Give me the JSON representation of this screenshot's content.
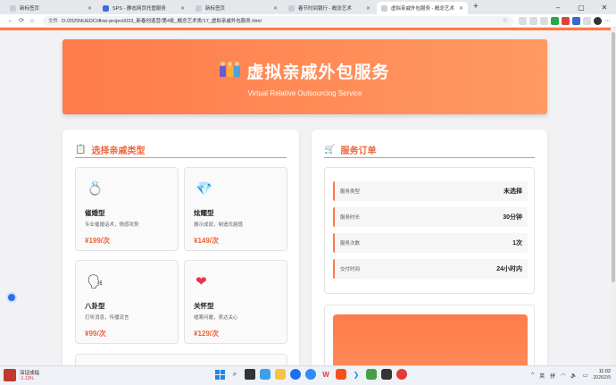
{
  "tabs": [
    {
      "label": "新标签页",
      "active": false
    },
    {
      "label": "SPS - 静态网页托管服务",
      "active": false
    },
    {
      "label": "新标签页",
      "active": false
    },
    {
      "label": "春节时间银行 - 概念艺术",
      "active": false
    },
    {
      "label": "虚拟亲戚外包服务 - 概念艺术",
      "active": true
    }
  ],
  "address": {
    "scheme_label": "文件",
    "url": "D:/2025NUEDC/iflow-project/033_新春创造营/第4批_概念艺术类/17_虚拟亲戚外包服务.html"
  },
  "hero": {
    "title": "虚拟亲戚外包服务",
    "subtitle": "Virtual Relative Outsourcing Service"
  },
  "left_card": {
    "title": "选择亲戚类型",
    "icon": "clipboard-icon",
    "options": [
      {
        "icon": "ring-icon",
        "glyph": "💍",
        "name": "催婚型",
        "desc": "专业催婚话术，情感攻势",
        "price": "¥199/次"
      },
      {
        "icon": "gem-icon",
        "glyph": "💎",
        "name": "炫耀型",
        "desc": "展示成就，制造优越感",
        "price": "¥149/次"
      },
      {
        "icon": "gossip-icon",
        "glyph": "🗣",
        "name": "八卦型",
        "desc": "打听消息，传播流言",
        "price": "¥99/次"
      },
      {
        "icon": "heart-icon",
        "glyph": "❤",
        "name": "关怀型",
        "desc": "嘘寒问暖，表达关心",
        "price": "¥129/次"
      }
    ]
  },
  "right_card": {
    "title": "服务订单",
    "icon": "cart-icon",
    "rows": [
      {
        "key": "服务类型",
        "value": "未选择"
      },
      {
        "key": "服务时长",
        "value": "30分钟"
      },
      {
        "key": "服务次数",
        "value": "1次"
      },
      {
        "key": "交付时间",
        "value": "24小时内"
      }
    ]
  },
  "taskbar": {
    "stock_name": "深证成指",
    "stock_change": "-1.13%",
    "ime_lang": "英",
    "ime_mode": "拼",
    "time": "11:02",
    "date": "2026/2/9"
  },
  "colors": {
    "accent": "#ff7a45",
    "accent_text": "#f0643a",
    "background": "#f2f2f4"
  }
}
